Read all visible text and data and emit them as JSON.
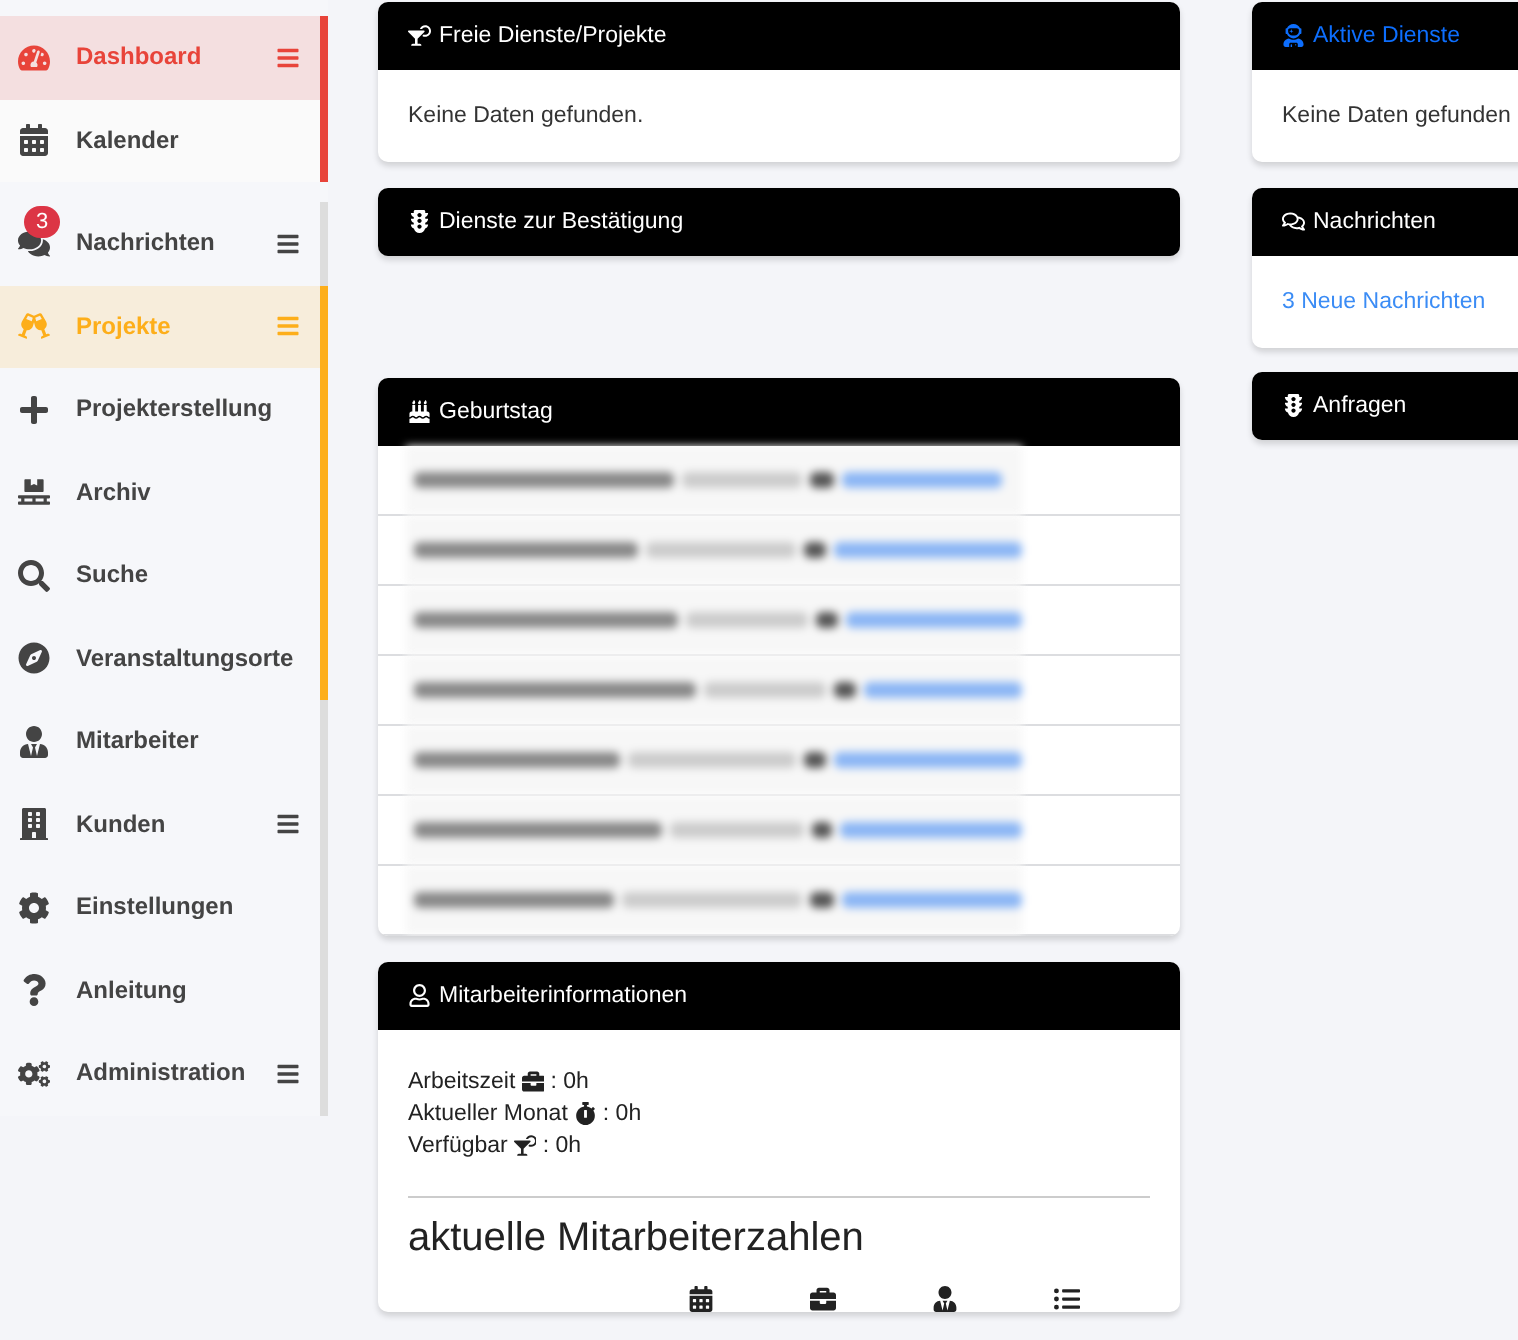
{
  "sidebar": {
    "groups": [
      {
        "color": "#e8443a",
        "items": [
          {
            "label": "Dashboard",
            "selected": true,
            "menu": true
          },
          {
            "label": "Kalender",
            "selected": false,
            "menu": false
          }
        ]
      },
      {
        "color": "#dddddd",
        "items": [
          {
            "label": "Nachrichten",
            "selected": false,
            "menu": true,
            "badge": "3"
          }
        ]
      },
      {
        "color": "#fdae1a",
        "items": [
          {
            "label": "Projekte",
            "selected": true,
            "menu": true
          },
          {
            "label": "Projekterstellung",
            "selected": false,
            "menu": false
          },
          {
            "label": "Archiv",
            "selected": false,
            "menu": false
          },
          {
            "label": "Suche",
            "selected": false,
            "menu": false
          },
          {
            "label": "Veranstaltungsorte",
            "selected": false,
            "menu": false
          }
        ]
      },
      {
        "color": "#dddddd",
        "items": [
          {
            "label": "Mitarbeiter",
            "selected": false,
            "menu": false
          },
          {
            "label": "Kunden",
            "selected": false,
            "menu": true
          },
          {
            "label": "Einstellungen",
            "selected": false,
            "menu": false
          },
          {
            "label": "Anleitung",
            "selected": false,
            "menu": false
          },
          {
            "label": "Administration",
            "selected": false,
            "menu": true
          }
        ]
      }
    ]
  },
  "left_cards": [
    {
      "kind": "text",
      "title": "Freie Dienste/Projekte",
      "body": "Keine Daten gefunden."
    },
    {
      "kind": "empty",
      "title": "Dienste zur Bestätigung"
    },
    {
      "kind": "blurred",
      "title": "Geburtstag"
    },
    {
      "kind": "info",
      "title": "Mitarbeiterinformationen",
      "lines": [
        {
          "label": "Arbeitszeit",
          "value": ": 0h"
        },
        {
          "label": "Aktueller Monat",
          "value": ": 0h"
        },
        {
          "label": "Verfügbar",
          "value": ": 0h"
        }
      ],
      "heading": "aktuelle Mitarbeiterzahlen"
    }
  ],
  "right_cards": [
    {
      "kind": "text",
      "title": "Aktive Dienste",
      "title_link": true,
      "body": "Keine Daten gefunden"
    },
    {
      "kind": "link",
      "title": "Nachrichten",
      "title_link": false,
      "body": "3 Neue Nachrichten"
    },
    {
      "kind": "empty",
      "title": "Anfragen",
      "title_link": false
    }
  ]
}
